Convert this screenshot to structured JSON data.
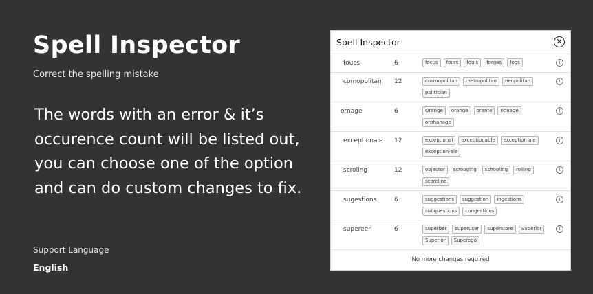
{
  "heading": {
    "title": "Spell Inspector",
    "subtitle": "Correct the spelling mistake"
  },
  "description": "The words with an error & it’s occurence count will be listed out, you can choose one of the option and can do custom changes to fix.",
  "support": {
    "label": "Support Language",
    "value": "English"
  },
  "panel": {
    "title": "Spell Inspector",
    "close_icon": "close-circle-icon",
    "rows": [
      {
        "word": "foucs",
        "count": "6",
        "suggestions": [
          "focus",
          "fours",
          "fouls",
          "forges",
          "fogs"
        ]
      },
      {
        "word": "comopolitan",
        "count": "12",
        "suggestions": [
          "cosmopolitan",
          "metropolitan",
          "neopolitan",
          "politician"
        ]
      },
      {
        "word": "ornage",
        "count": "6",
        "suggestions": [
          "Orange",
          "orange",
          "orante",
          "nonage",
          "orphanage"
        ]
      },
      {
        "word": "exceptionale",
        "count": "12",
        "suggestions": [
          "exceptional",
          "exceptionable",
          "exception ale",
          "exception-ale"
        ]
      },
      {
        "word": "scroling",
        "count": "12",
        "suggestions": [
          "objector",
          "scrooging",
          "schooling",
          "rolling",
          "scoreline"
        ]
      },
      {
        "word": "sugestions",
        "count": "6",
        "suggestions": [
          "suggestions",
          "suggestion",
          "ingestions",
          "subquestions",
          "congestions"
        ]
      },
      {
        "word": "supereer",
        "count": "6",
        "suggestions": [
          "superber",
          "superuser",
          "superstore",
          "Superior",
          "Superior",
          "Superego"
        ]
      }
    ],
    "info_icon": "info-icon",
    "footer": "No more changes required"
  }
}
